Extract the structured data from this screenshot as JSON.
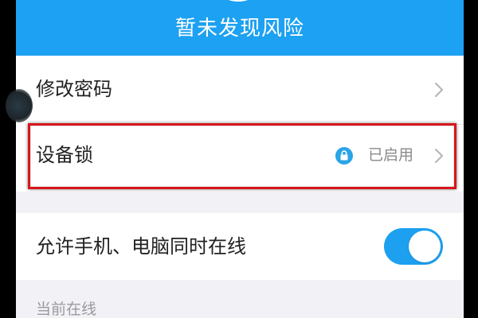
{
  "banner": {
    "title": "暂未发现风险",
    "ring_icon": "status-ring-icon",
    "color": "#1da1f2"
  },
  "settings": {
    "change_password": {
      "label": "修改密码",
      "icon": "chevron-right-icon"
    },
    "device_lock": {
      "label": "设备锁",
      "status": "已启用",
      "status_icon": "lock-icon",
      "icon": "chevron-right-icon",
      "highlight_color": "#d7151b"
    },
    "multi_online": {
      "label": "允许手机、电脑同时在线",
      "toggle_on": true
    }
  },
  "section": {
    "current_online_label": "当前在线"
  },
  "colors": {
    "accent": "#1da1f2",
    "toggle_on": "#1ca0ef",
    "section_background": "#f2f2f6",
    "primary_text": "#222222",
    "secondary_text": "#8a8a8e"
  }
}
